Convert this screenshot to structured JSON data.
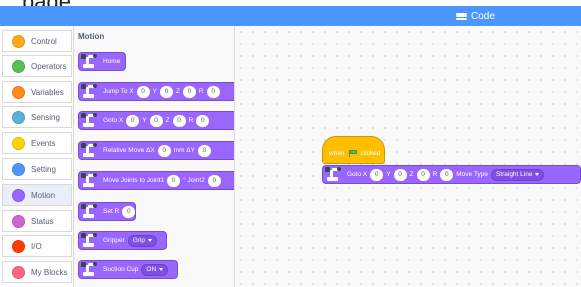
{
  "page_heading": "page.",
  "topbar": {
    "code_tab_label": "Code",
    "code_tab_icon": "code-icon"
  },
  "categories": [
    {
      "label": "Control",
      "color": "#ffab19"
    },
    {
      "label": "Operators",
      "color": "#59c059"
    },
    {
      "label": "Variables",
      "color": "#ff8c1a"
    },
    {
      "label": "Sensing",
      "color": "#5cb1d6"
    },
    {
      "label": "Events",
      "color": "#ffd500"
    },
    {
      "label": "Setting",
      "color": "#4c97ff"
    },
    {
      "label": "Motion",
      "color": "#9966ff"
    },
    {
      "label": "Status",
      "color": "#cf63cf"
    },
    {
      "label": "I/O",
      "color": "#ff3d00"
    },
    {
      "label": "My Blocks",
      "color": "#ff6680"
    }
  ],
  "active_category": "Motion",
  "palette": {
    "title": "Motion",
    "blocks": {
      "home": {
        "label": "Home"
      },
      "jump_to": {
        "label": "Jump To X",
        "y": "Y",
        "z": "Z",
        "r": "R",
        "x_val": "0",
        "y_val": "0",
        "z_val": "0",
        "r_val": "0"
      },
      "goto": {
        "label": "Goto X",
        "y": "Y",
        "z": "Z",
        "r": "R",
        "x_val": "0",
        "y_val": "0",
        "z_val": "0",
        "r_val": "0"
      },
      "relative_move": {
        "label": "Relative Move ΔX",
        "unit": "mm ΔY",
        "x_val": "0",
        "y_val": "0"
      },
      "move_joints": {
        "label": "Move Joints to Joint1",
        "joint2": "° Joint2",
        "j1_val": "0",
        "j2_val": "0"
      },
      "set_r": {
        "label": "Set R",
        "unit": "°",
        "r_val": "0"
      },
      "gripper": {
        "label": "Gripper",
        "option": "Grip"
      },
      "suction_cup": {
        "label": "Suction Cup",
        "option": "ON"
      }
    }
  },
  "workspace": {
    "hat": {
      "when": "when",
      "clicked": "clicked"
    },
    "goto_block": {
      "label": "Goto X",
      "y": "Y",
      "z": "Z",
      "r": "R",
      "x_val": "0",
      "y_val": "0",
      "z_val": "0",
      "r_val": "0",
      "move_type_label": "Move Type",
      "move_type_value": "Straight Line"
    }
  },
  "colors": {
    "motion": "#9966ff",
    "events": "#ffbf00",
    "topbar": "#4c97ff"
  }
}
